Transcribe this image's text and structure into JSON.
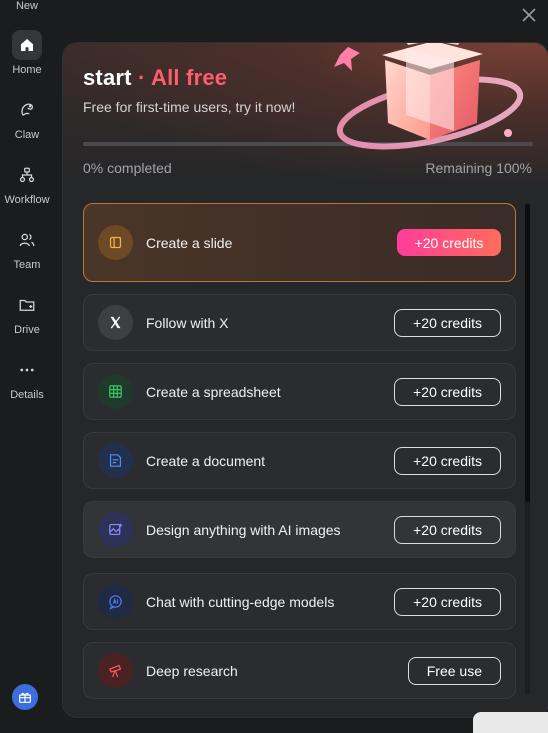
{
  "rail": {
    "new_label": "New",
    "items": [
      {
        "label": "Home",
        "icon": "home-icon"
      },
      {
        "label": "Claw",
        "icon": "claw-icon"
      },
      {
        "label": "Workflow",
        "icon": "workflow-icon"
      },
      {
        "label": "Team",
        "icon": "team-icon"
      },
      {
        "label": "Drive",
        "icon": "drive-icon"
      },
      {
        "label": "Details",
        "icon": "more-icon"
      }
    ]
  },
  "panel": {
    "title_start": "start",
    "title_sep": " · ",
    "title_accent": "All free",
    "subtitle": "Free for first-time users, try it now!",
    "progress_fraction": 0.0,
    "progress_left": "0% completed",
    "progress_right": "Remaining 100%"
  },
  "tasks": [
    {
      "label": "Create a slide",
      "button": "+20 credits",
      "icon": "slide-icon"
    },
    {
      "label": "Follow with X",
      "button": "+20 credits",
      "icon": "x-logo-icon"
    },
    {
      "label": "Create a spreadsheet",
      "button": "+20 credits",
      "icon": "spreadsheet-icon"
    },
    {
      "label": "Create a document",
      "button": "+20 credits",
      "icon": "document-icon"
    },
    {
      "label": "Design anything with AI images",
      "button": "+20 credits",
      "icon": "ai-image-icon"
    },
    {
      "label": "Chat with cutting-edge models",
      "button": "+20 credits",
      "icon": "ai-chat-icon"
    },
    {
      "label": "Deep research",
      "button": "Free use",
      "icon": "telescope-icon"
    }
  ],
  "colors": {
    "accent": "#ff5d6c",
    "credits_gradient_start": "#ff3d9a",
    "credits_gradient_end": "#ff6d5a",
    "highlight_border": "#b8763a"
  }
}
